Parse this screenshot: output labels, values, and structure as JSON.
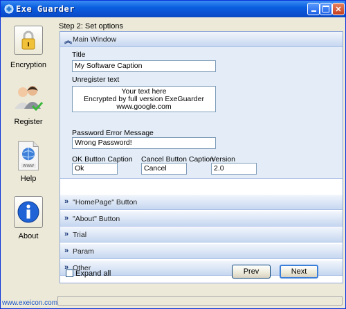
{
  "window": {
    "title": "Exe Guarder",
    "controls": [
      "minimize",
      "maximize",
      "close"
    ]
  },
  "nav": [
    {
      "label": "Encryption",
      "icon": "padlock-icon"
    },
    {
      "label": "Register",
      "icon": "users-check-icon"
    },
    {
      "label": "Help",
      "icon": "web-page-icon"
    },
    {
      "label": "About",
      "icon": "info-icon"
    }
  ],
  "step_label": "Step 2: Set options",
  "main_window": {
    "header": "Main Window",
    "title_label": "Title",
    "title_value": "My Software Caption",
    "unregister_label": "Unregister text",
    "unregister_lines": [
      "Your text here",
      "Encrypted by full version ExeGuarder",
      "www.google.com"
    ],
    "password_error_label": "Password Error Message",
    "password_error_value": "Wrong Password!",
    "ok_caption_label": "OK Button Caption",
    "ok_caption_value": "Ok",
    "cancel_caption_label": "Cancel Button Caption",
    "cancel_caption_value": "Cancel",
    "version_label": "Version",
    "version_value": "2.0"
  },
  "sections": [
    "\"HomePage\" Button",
    "\"About\" Button",
    "Trial",
    "Param",
    "Other"
  ],
  "expand_all": {
    "label": "Expand all",
    "checked": false
  },
  "buttons": {
    "prev": "Prev",
    "next": "Next"
  },
  "status": {
    "url": "www.exeicon.com"
  },
  "colors": {
    "title_bar": "#0a5fe0",
    "section_header": "#c6d7f0",
    "accent_blue": "#1a56c8"
  }
}
